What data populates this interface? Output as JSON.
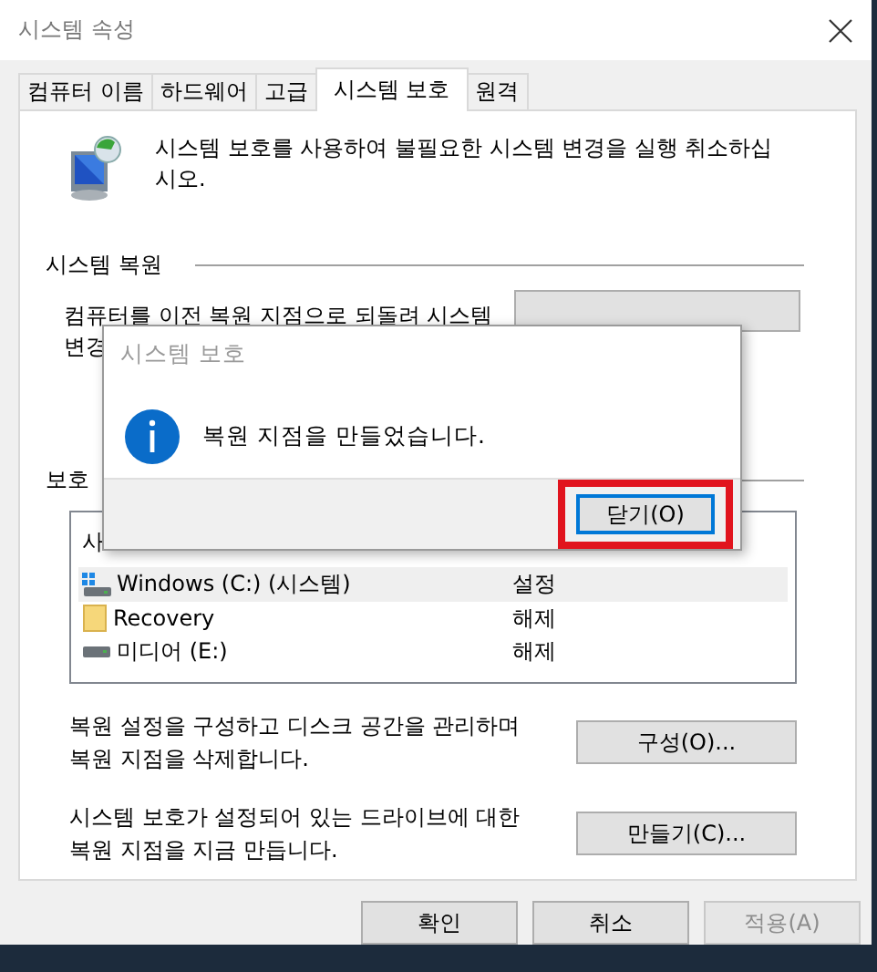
{
  "window": {
    "title": "시스템 속성"
  },
  "tabs": [
    {
      "label": "컴퓨터 이름",
      "selected": false
    },
    {
      "label": "하드웨어",
      "selected": false
    },
    {
      "label": "고급",
      "selected": false
    },
    {
      "label": "시스템 보호",
      "selected": true
    },
    {
      "label": "원격",
      "selected": false
    }
  ],
  "intro": "시스템 보호를 사용하여 불필요한 시스템 변경을 실행 취소하십시오.",
  "restore_section": {
    "heading": "시스템 복원",
    "description_lines": [
      "컴퓨터를 이전 복원 지점으로 되돌려 시스템",
      "변경"
    ]
  },
  "protection_section": {
    "heading": "보호",
    "table": {
      "columns": [
        "사"
      ],
      "rows": [
        {
          "drive": "Windows (C:) (시스템)",
          "protection": "설정",
          "selected": true,
          "kind": "system-drive"
        },
        {
          "drive": "Recovery",
          "protection": "해제",
          "selected": false,
          "kind": "folder"
        },
        {
          "drive": "미디어 (E:)",
          "protection": "해제",
          "selected": false,
          "kind": "drive"
        }
      ]
    }
  },
  "actions": [
    {
      "description": "복원 설정을 구성하고 디스크 공간을 관리하며 복원 지점을 삭제합니다.",
      "button": "구성(O)..."
    },
    {
      "description": "시스템 보호가 설정되어 있는 드라이브에 대한 복원 지점을 지금 만듭니다.",
      "button": "만들기(C)..."
    }
  ],
  "buttons": [
    {
      "label": "확인",
      "disabled": false
    },
    {
      "label": "취소",
      "disabled": false
    },
    {
      "label": "적용(A)",
      "disabled": true
    }
  ],
  "dialog": {
    "title": "시스템 보호",
    "message": "복원 지점을 만들었습니다.",
    "button": "닫기(O)",
    "highlighted": true
  }
}
